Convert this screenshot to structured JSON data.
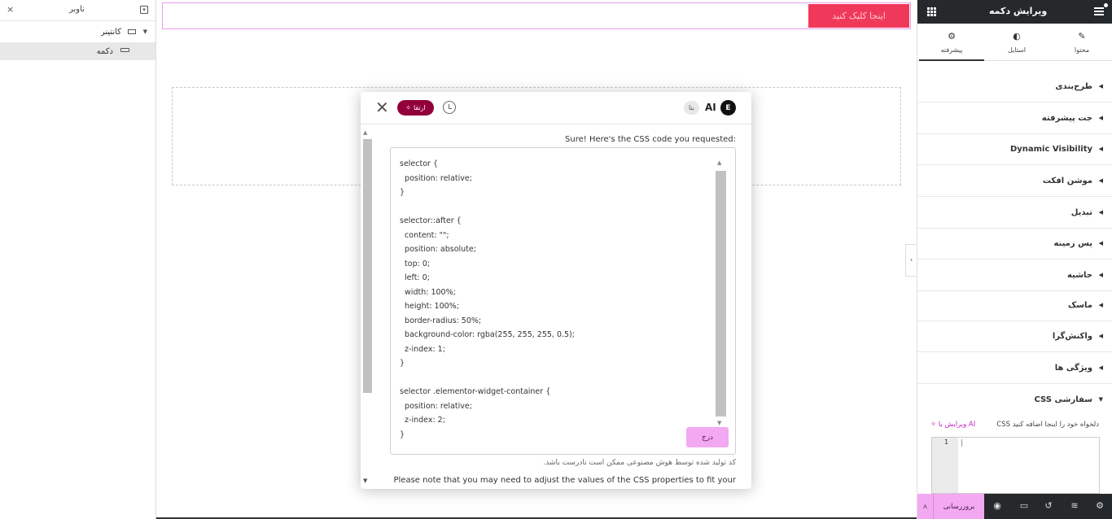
{
  "navigator": {
    "title": "ناوبر",
    "close": "×",
    "collapse": "▾",
    "tree": [
      {
        "label": "کانتینر",
        "expanded": true
      },
      {
        "label": "دکمه"
      }
    ]
  },
  "canvas": {
    "cta_button": "اینجا کلیک کنید",
    "cta_color": "#f0395a"
  },
  "ai_dialog": {
    "ai_label": "AI",
    "beta_badge": "بتا",
    "upgrade_badge": "ارتقا",
    "reply_intro": "Sure! Here's the CSS code you requested:",
    "code": "selector {\n  position: relative;\n}\n\nselector::after {\n  content: \"\";\n  position: absolute;\n  top: 0;\n  left: 0;\n  width: 100%;\n  height: 100%;\n  border-radius: 50%;\n  background-color: rgba(255, 255, 255, 0.5);\n  z-index: 1;\n}\n\nselector .elementor-widget-container {\n  position: relative;\n  z-index: 2;\n}",
    "insert_button": "درج",
    "disclaimer": "کد تولید شده توسط هوش مصنوعی ممکن است نادرست باشد.",
    "note": "Please note that you may need to adjust the values of the CSS properties to fit your"
  },
  "editor_panel": {
    "title": "ویرایش دکمه",
    "tabs": [
      {
        "label": "محتوا",
        "icon": "pencil-icon"
      },
      {
        "label": "استایل",
        "icon": "half-circle-icon"
      },
      {
        "label": "پیشرفته",
        "icon": "gear-icon",
        "active": true
      }
    ],
    "sections": [
      "طرح‌بندی",
      "جت پیشرفته",
      "Dynamic Visibility",
      "موشن افکت",
      "تبدیل",
      "پس زمینه",
      "حاشیه",
      "ماسک",
      "واکنش‌گرا",
      "ویژگی ها",
      "CSS سفارشی"
    ],
    "css_hint": "CSS دلخواه خود را اینجا اضافه کنید",
    "ai_edit_link": "ویرایش با AI",
    "css_line_number": "1",
    "footer": {
      "update_button": "بروزرسانی"
    },
    "accent_color": "#f3a9f2"
  }
}
